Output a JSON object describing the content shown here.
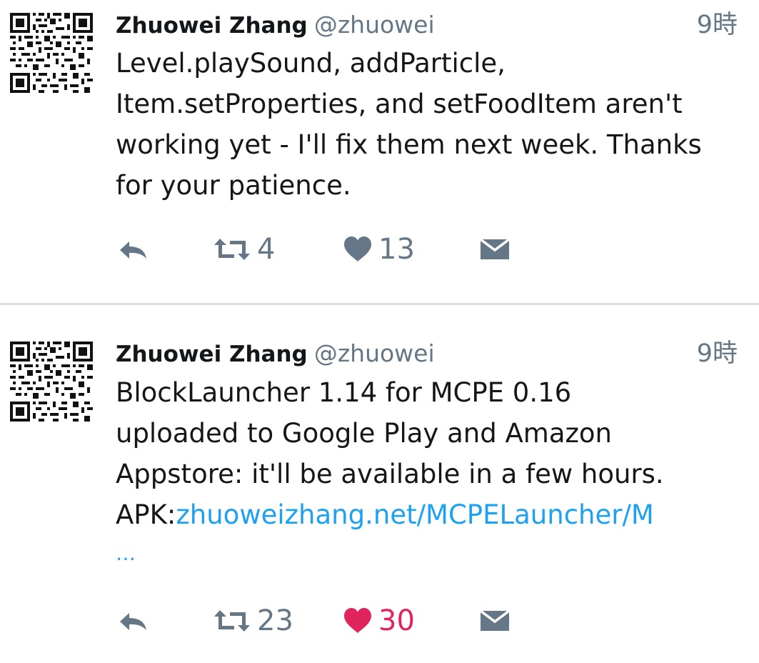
{
  "tweets": [
    {
      "author_name": "Zhuowei Zhang",
      "handle": "@zhuowei",
      "time": "9時",
      "text_lines": [
        "Level.playSound, addParticle,",
        "Item.setProperties, and setFoodItem aren't",
        "working yet - I'll fix them next week. Thanks",
        "for your patience."
      ],
      "retweet_count": "4",
      "like_count": "13",
      "liked": false,
      "icons": [
        "qr-code-avatar-icon",
        "reply-icon",
        "retweet-icon",
        "heart-icon",
        "direct-message-icon"
      ]
    },
    {
      "author_name": "Zhuowei Zhang",
      "handle": "@zhuowei",
      "time": "9時",
      "text_lines": [
        "BlockLauncher 1.14 for MCPE 0.16",
        "uploaded to Google Play and Amazon",
        "Appstore: it'll be available in a few hours."
      ],
      "link_prefix": "APK:",
      "link_text": "zhuoweizhang.net/MCPELauncher/M",
      "link_ellipsis": "…",
      "retweet_count": "23",
      "like_count": "30",
      "liked": true,
      "icons": [
        "qr-code-avatar-icon",
        "reply-icon",
        "retweet-icon",
        "heart-icon",
        "direct-message-icon"
      ]
    }
  ],
  "colors": {
    "text": "#14171a",
    "muted": "#657786",
    "link": "#1da1f2",
    "like_active": "#e0245e",
    "divider": "#d8dfe6"
  }
}
